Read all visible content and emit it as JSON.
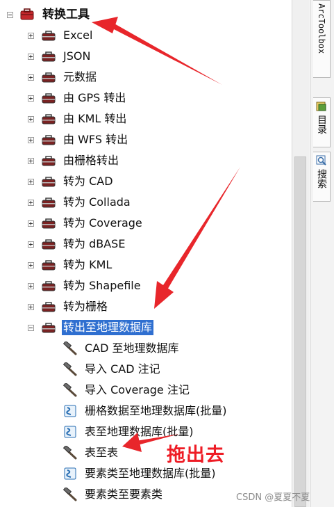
{
  "tree": {
    "root": {
      "label": "转换工具"
    },
    "items": [
      {
        "label": "Excel"
      },
      {
        "label": "JSON"
      },
      {
        "label": "元数据"
      },
      {
        "label": "由 GPS 转出"
      },
      {
        "label": "由 KML 转出"
      },
      {
        "label": "由 WFS 转出"
      },
      {
        "label": "由栅格转出"
      },
      {
        "label": "转为 CAD"
      },
      {
        "label": "转为 Collada"
      },
      {
        "label": "转为 Coverage"
      },
      {
        "label": "转为 dBASE"
      },
      {
        "label": "转为 KML"
      },
      {
        "label": "转为 Shapefile"
      },
      {
        "label": "转为栅格"
      }
    ],
    "expanded": {
      "label": "转出至地理数据库",
      "children": [
        {
          "label": "CAD 至地理数据库",
          "icon": "hammer-icon"
        },
        {
          "label": "导入 CAD 注记",
          "icon": "hammer-icon"
        },
        {
          "label": "导入 Coverage 注记",
          "icon": "hammer-icon"
        },
        {
          "label": "栅格数据至地理数据库(批量)",
          "icon": "script-icon"
        },
        {
          "label": "表至地理数据库(批量)",
          "icon": "script-icon"
        },
        {
          "label": "表至表",
          "icon": "hammer-icon"
        },
        {
          "label": "要素类至地理数据库(批量)",
          "icon": "script-icon"
        },
        {
          "label": "要素类至要素类",
          "icon": "hammer-icon"
        }
      ]
    }
  },
  "side_tabs": {
    "arctoolbox": "ArcToolbox",
    "catalog": "目录",
    "search": "搜索"
  },
  "annotation": {
    "text": "拖出去",
    "color": "#ee1c25"
  },
  "watermark": "CSDN @夏夏不夏",
  "colors": {
    "selection": "#2f6fd0",
    "arrow": "#e8262b"
  }
}
